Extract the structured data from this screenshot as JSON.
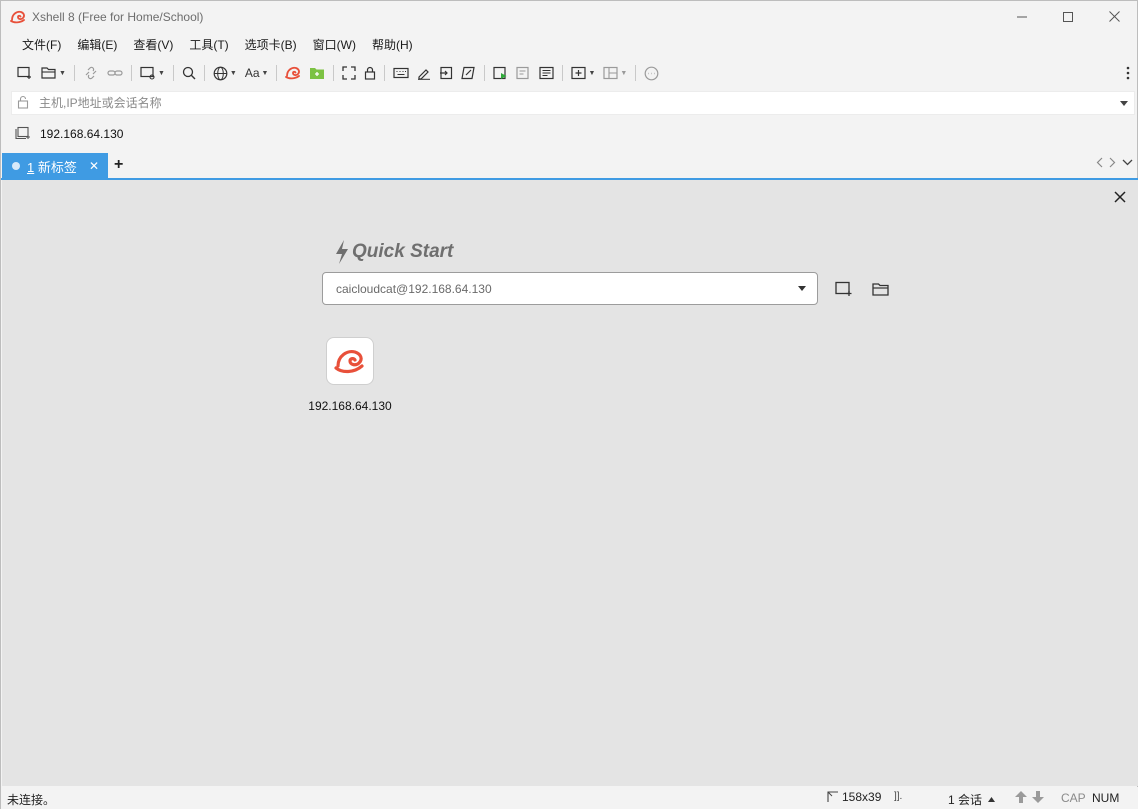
{
  "window": {
    "title": "Xshell 8 (Free for Home/School)",
    "controls": [
      "minimize-icon",
      "maximize-icon",
      "close-icon"
    ]
  },
  "menu": {
    "items": [
      "文件(F)",
      "编辑(E)",
      "查看(V)",
      "工具(T)",
      "选项卡(B)",
      "窗口(W)",
      "帮助(H)"
    ]
  },
  "toolbar": {
    "font_label": "Aa"
  },
  "address": {
    "placeholder": "主机,IP地址或会话名称"
  },
  "session_bar": {
    "link": "192.168.64.130"
  },
  "tabs": {
    "active_number": "1",
    "active_label": "新标签"
  },
  "quick_start": {
    "title": "Quick Start",
    "selected": "caicloudcat@192.168.64.130",
    "sessions": [
      {
        "label": "192.168.64.130"
      }
    ]
  },
  "status": {
    "message": "未连接。",
    "terminal_size": "158x39",
    "sessions": "1 会话",
    "cap": "CAP",
    "num": "NUM"
  },
  "colors": {
    "accent": "#3f9be3",
    "brand": "#e8503a",
    "content_bg": "#e4e4e4"
  }
}
